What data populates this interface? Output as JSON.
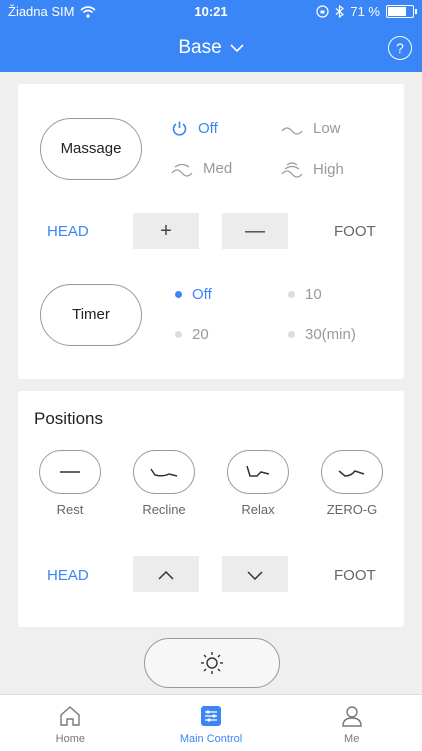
{
  "status": {
    "carrier": "Žiadna SIM",
    "time": "10:21",
    "battery": "71 %"
  },
  "header": {
    "title": "Base"
  },
  "massage": {
    "button": "Massage",
    "options": [
      {
        "label": "Off",
        "active": true
      },
      {
        "label": "Low",
        "active": false
      },
      {
        "label": "Med",
        "active": false
      },
      {
        "label": "High",
        "active": false
      }
    ]
  },
  "control1": {
    "head": "HEAD",
    "foot": "FOOT",
    "plus": "+",
    "minus": "—"
  },
  "timer": {
    "button": "Timer",
    "options": [
      {
        "label": "Off",
        "active": true
      },
      {
        "label": "10",
        "active": false
      },
      {
        "label": "20",
        "active": false
      },
      {
        "label": "30(min)",
        "active": false
      }
    ]
  },
  "positions": {
    "title": "Positions",
    "items": [
      {
        "label": "Rest"
      },
      {
        "label": "Recline"
      },
      {
        "label": "Relax"
      },
      {
        "label": "ZERO-G"
      }
    ]
  },
  "control2": {
    "head": "HEAD",
    "foot": "FOOT"
  },
  "tabs": [
    {
      "label": "Home",
      "active": false
    },
    {
      "label": "Main Control",
      "active": true
    },
    {
      "label": "Me",
      "active": false
    }
  ]
}
